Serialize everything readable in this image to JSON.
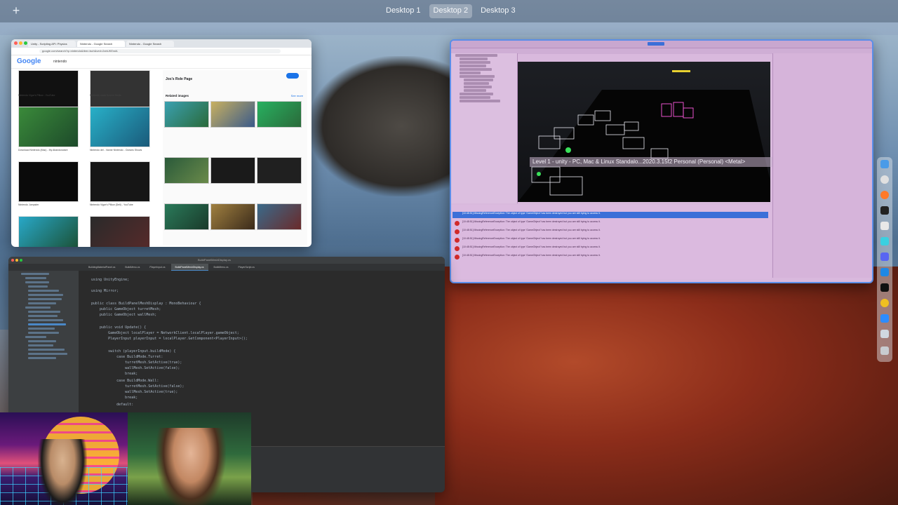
{
  "mission_control": {
    "add_space": "+",
    "desktops": [
      "Desktop 1",
      "Desktop 2",
      "Desktop 3"
    ],
    "active_desktop": "Desktop 2"
  },
  "chrome": {
    "tabs": [
      "Unity - Scripting API: Physics",
      "Nintendo - Google Search",
      "Nintendo - Google Search"
    ],
    "url": "google.com/search?q=nintendo&tbm=isch&ved=2ahUKEwiA",
    "logo": "Google",
    "query": "nintendo",
    "captions": [
      "Nintendo Vigar's Pillow - YouTube",
      "Nintendo nada Screen Shots",
      "Download Nintendo (Mac) - My Abandonware",
      "Nintendo del - Vanne Nintendo - Oceans Shows",
      "Nintendo Jumpster",
      "Nintendo Vigar's Pillow (Dell) - YouTube",
      "",
      ""
    ],
    "panel_title": "Jos's Role Page",
    "related_label": "Related images",
    "see_more": "See more"
  },
  "unity": {
    "tooltip": "Level 1 - unity - PC, Mac & Linux Standalo...2020.3.15f2 Personal (Personal) <Metal>",
    "console_rows": [
      "[10:48:51] MissingReferenceException: The object of type 'GameObject' has been destroyed but you are still trying to access it.",
      "[10:48:51] MissingReferenceException: The object of type 'GameObject' has been destroyed but you are still trying to access it.",
      "[10:48:51] MissingReferenceException: The object of type 'GameObject' has been destroyed but you are still trying to access it.",
      "[10:48:51] MissingReferenceException: The object of type 'GameObject' has been destroyed but you are still trying to access it.",
      "[10:48:51] MissingReferenceException: The object of type 'GameObject' has been destroyed but you are still trying to access it.",
      "[10:48:51] MissingReferenceException: The object of type 'GameObject' has been destroyed but you are still trying to access it."
    ]
  },
  "ide": {
    "title": "BuildPanelMeshDisplay.cs",
    "tabs": [
      "BuildingMaterialPanel.cs",
      "BuildMenu.cs",
      "PlayerInput.cs",
      "BuildPanelMeshDisplay.cs",
      "BuildMenu.cs",
      "PlayerScript.cs"
    ],
    "active_tab": "BuildPanelMeshDisplay.cs",
    "code": [
      "using UnityEngine;",
      "",
      "using Mirror;",
      "",
      "public class BuildPanelMeshDisplay : MonoBehaviour {",
      "    public GameObject turretMesh;",
      "    public GameObject wallMesh;",
      "",
      "    public void Update() {",
      "        GameObject localPlayer = NetworkClient.localPlayer.gameObject;",
      "        PlayerInput playerInput = localPlayer.GetComponent<PlayerInput>();",
      "",
      "        switch (playerInput.buildMode) {",
      "            case BuildMode.Turret:",
      "                turretMesh.SetActive(true);",
      "                wallMesh.SetActive(false);",
      "                break;",
      "            case BuildMode.Wall:",
      "                turretMesh.SetActive(false);",
      "                wallMesh.SetActive(true);",
      "                break;",
      "            default:"
    ]
  },
  "colors": {
    "unity_bg": "#d9b9dd",
    "unity_selection": "#3b6fd8",
    "error_red": "#d12a2a",
    "ide_bg": "#2b2b2b",
    "chrome_accent": "#1a73e8"
  },
  "dock_icons": [
    "finder-icon",
    "chrome-icon",
    "firefox-icon",
    "terminal-icon",
    "unity-icon",
    "rider-icon",
    "discord-icon",
    "vscode-icon",
    "unity-hub-icon",
    "chrome-canary-icon",
    "zoom-icon",
    "preview-icon",
    "trash-icon"
  ]
}
